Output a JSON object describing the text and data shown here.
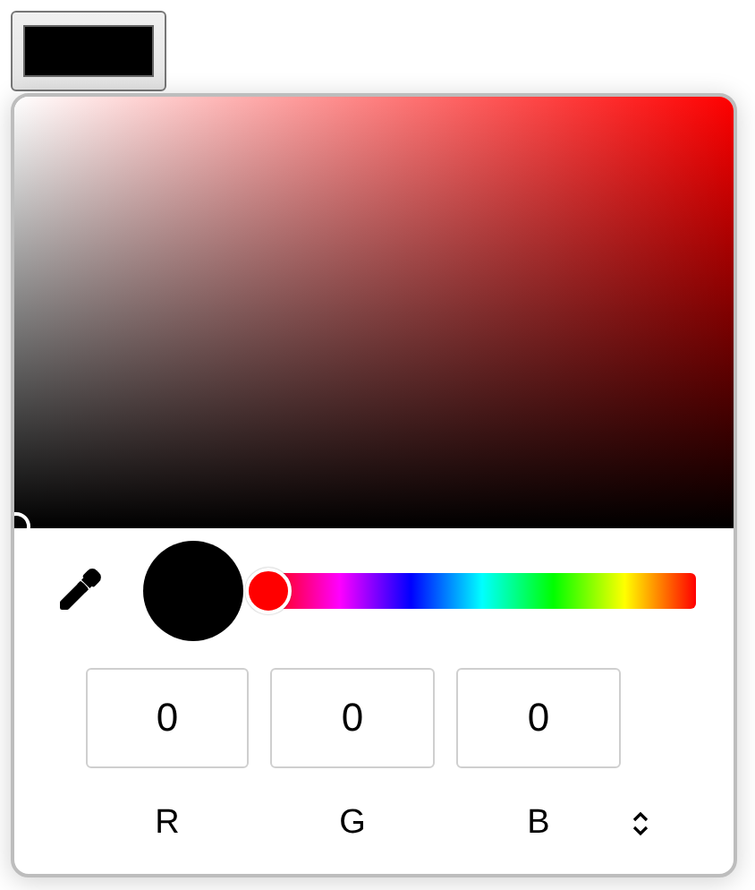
{
  "swatch": {
    "color": "#000000"
  },
  "hue_slider": {
    "level": 0
  },
  "channels": [
    {
      "value": "0",
      "label": "R"
    },
    {
      "value": "0",
      "label": "G"
    },
    {
      "value": "0",
      "label": "B"
    }
  ]
}
